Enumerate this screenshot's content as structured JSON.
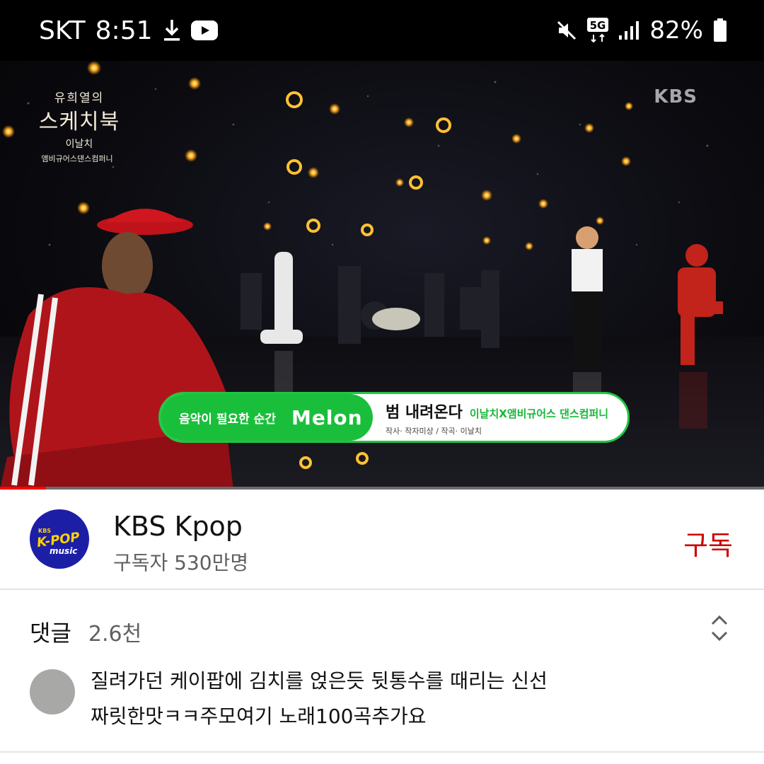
{
  "status_bar": {
    "carrier": "SKT",
    "time": "8:51",
    "network": "5G",
    "battery": "82%",
    "icons": [
      "download-icon",
      "youtube-icon",
      "mute-icon",
      "5g-icon",
      "signal-icon",
      "battery-icon"
    ]
  },
  "video": {
    "show_logo": {
      "line1": "유희열의",
      "line2": "스케치북",
      "line3": "이날치",
      "line4": "앰비규어스댄스컴퍼니"
    },
    "watermark": "KBS",
    "melon_banner": {
      "tagline": "음악이 필요한 순간",
      "logo": "Melon",
      "song_title": "범 내려온다",
      "artist": "이날치X앰비규어스 댄스컴퍼니",
      "credit": "작사· 작자미상 / 작곡· 이날치"
    },
    "progress_fraction": 0.06
  },
  "channel": {
    "name": "KBS Kpop",
    "subscribers": "구독자 530만명",
    "subscribe_label": "구독",
    "avatar_text": {
      "top": "KBS",
      "middle": "K-POP",
      "bottom": "music"
    }
  },
  "comments": {
    "label": "댓글",
    "count": "2.6천",
    "top_comment": {
      "line1": "질려가던 케이팝에 김치를 얹은듯 뒷통수를 때리는 신선",
      "line2": "짜릿한맛ㅋㅋ주모여기 노래100곡추가요"
    }
  },
  "colors": {
    "accent_red": "#cc0000",
    "progress_red": "#ff0000",
    "melon_green": "#19bf3a",
    "channel_avatar_bg": "#1d1ea6"
  }
}
